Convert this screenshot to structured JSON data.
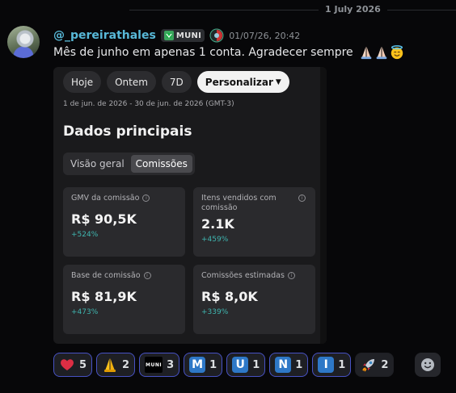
{
  "divider": {
    "date": "1 July 2026"
  },
  "message": {
    "username": "@_pereirathales",
    "tag": "MUNI",
    "timestamp": "01/07/26, 20:42",
    "text": "Mês de junho em apenas 1 conta. Agradecer sempre",
    "emojis": [
      "folded-hands",
      "folded-hands",
      "smiling-face-with-halo"
    ]
  },
  "screenshot": {
    "pills": [
      "Hoje",
      "Ontem",
      "7D",
      "Personalizar"
    ],
    "active_pill": "Personalizar",
    "date_range": "1 de jun. de 2026 - 30 de jun. de 2026 (GMT-3)",
    "section_title": "Dados principais",
    "tabs": [
      "Visão geral",
      "Comissões"
    ],
    "active_tab": "Comissões",
    "cards": [
      {
        "label": "GMV da comissão",
        "value": "R$ 90,5K",
        "delta": "+524%"
      },
      {
        "label": "Itens vendidos com comissão",
        "value": "2.1K",
        "delta": "+459%"
      },
      {
        "label": "Base de comissão",
        "value": "R$ 81,9K",
        "delta": "+473%"
      },
      {
        "label": "Comissões estimadas",
        "value": "R$ 8,0K",
        "delta": "+339%"
      }
    ]
  },
  "reactions": [
    {
      "emoji": "red-heart",
      "count": "5"
    },
    {
      "emoji": "folded-hands",
      "count": "2"
    },
    {
      "emoji": "muni-logo",
      "count": "3"
    },
    {
      "emoji": "letter-M",
      "letter": "M",
      "count": "1"
    },
    {
      "emoji": "letter-U",
      "letter": "U",
      "count": "1"
    },
    {
      "emoji": "letter-N",
      "letter": "N",
      "count": "1"
    },
    {
      "emoji": "letter-I",
      "letter": "I",
      "count": "1"
    },
    {
      "emoji": "rocket",
      "count": "2"
    }
  ],
  "colors": {
    "username": "#58b9d8",
    "delta": "#3fb6b0",
    "reaction_border": "#4752c4",
    "letter_emoji_bg": "#2e78c7"
  }
}
